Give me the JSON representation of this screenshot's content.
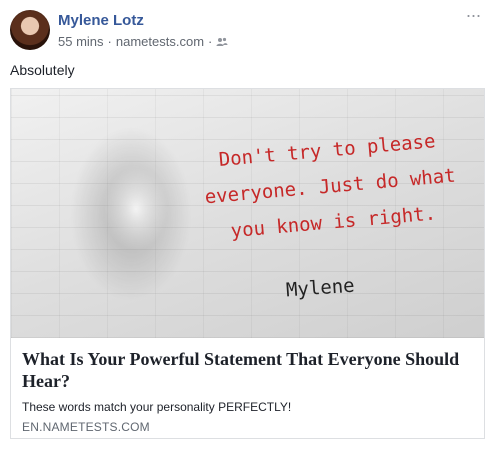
{
  "post": {
    "author": "Mylene Lotz",
    "time": "55 mins",
    "separator": "·",
    "source": "nametests.com",
    "separator2": "·",
    "audience_icon": "friends-icon",
    "more_icon": "more-options-icon",
    "more_glyph": "···",
    "text": "Absolutely"
  },
  "card": {
    "image_quote_lines": [
      "Don't try to please",
      "everyone. Just do what",
      "you know is right."
    ],
    "image_signature": "Mylene",
    "title": "What Is Your Powerful Statement That Everyone Should Hear?",
    "description": "These words match your personality PERFECTLY!",
    "domain": "EN.NAMETESTS.COM"
  },
  "colors": {
    "author_link": "#365899",
    "meta_text": "#616770",
    "quote_red": "#c62828",
    "border": "#dddfe2"
  }
}
